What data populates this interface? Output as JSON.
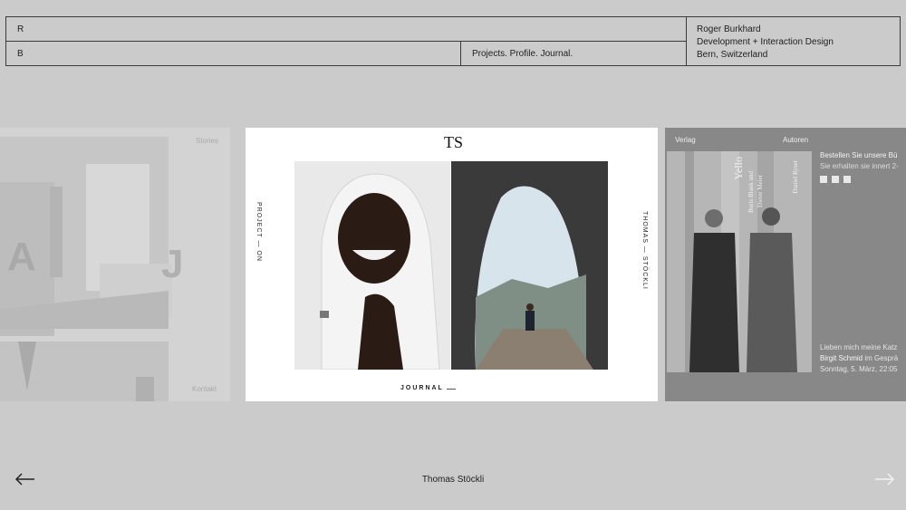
{
  "header": {
    "logo_top": "R",
    "logo_bottom": "B",
    "nav": "Projects. Profile. Journal.",
    "name": "Roger Burkhard",
    "role": "Development + Interaction Design",
    "location": "Bern, Switzerland"
  },
  "slides": {
    "left": {
      "label_top": "Stories",
      "label_bottom": "Kontakt",
      "letter_a": "A",
      "letter_j": "J"
    },
    "middle": {
      "logo": "TS",
      "vertical_left": "PROJECT — ON",
      "vertical_right": "THOMAS — STÖCKLI",
      "footer": "JOURNAL"
    },
    "right": {
      "nav_verlag": "Verlag",
      "nav_autoren": "Autoren",
      "order_title": "Bestellen Sie unsere Bü",
      "order_sub": "Sie erhalten sie innert 2-",
      "book_title": "Yello",
      "book_author1": "Boris Blank und",
      "book_author2": "Dieter Meier",
      "book_author3": "Daniel Ryser",
      "quote_line1": "Lieben mich meine Katz",
      "quote_name": "Birgit Schmid",
      "quote_rest": " im Gesprä",
      "quote_date": "Sonntag, 5. März, 22:05"
    }
  },
  "footer": {
    "caption": "Thomas Stöckli"
  },
  "colors": {
    "background": "#cbcbcb",
    "border": "#3a3a3a",
    "accent_link": "#f2f2f2"
  }
}
